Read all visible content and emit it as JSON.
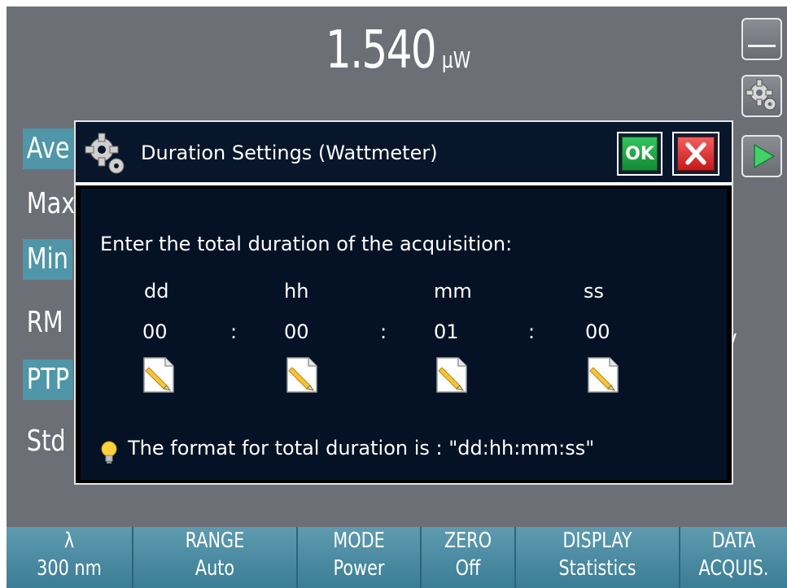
{
  "reading": {
    "value": "1.540",
    "unit": "µW"
  },
  "stats": {
    "labels": [
      "Ave",
      "Max",
      "Min",
      "RM",
      "PTP",
      "Std"
    ],
    "right_fragment": "/"
  },
  "side_buttons": [
    "minimize-icon",
    "gear-icon",
    "play-icon"
  ],
  "dialog": {
    "title": "Duration Settings  (Wattmeter)",
    "ok_label": "OK",
    "prompt": "Enter the total duration of the acquisition:",
    "fields": [
      {
        "head": "dd",
        "value": "00"
      },
      {
        "head": "hh",
        "value": "00"
      },
      {
        "head": "mm",
        "value": "01"
      },
      {
        "head": "ss",
        "value": "00"
      }
    ],
    "separator": ":",
    "hint": "The format for total duration is : \"dd:hh:mm:ss\""
  },
  "bottom_bar": [
    {
      "line1": "λ",
      "line2": "300 nm"
    },
    {
      "line1": "RANGE",
      "line2": "Auto"
    },
    {
      "line1": "MODE",
      "line2": "Power"
    },
    {
      "line1": "ZERO",
      "line2": "Off"
    },
    {
      "line1": "DISPLAY",
      "line2": "Statistics"
    },
    {
      "line1": "DATA",
      "line2": "ACQUIS."
    }
  ],
  "colors": {
    "screen_bg": "#6c6f76",
    "dialog_bg": "#051226",
    "accent": "#4f96a8",
    "ok_green": "#1fa847",
    "close_red": "#e03030"
  }
}
